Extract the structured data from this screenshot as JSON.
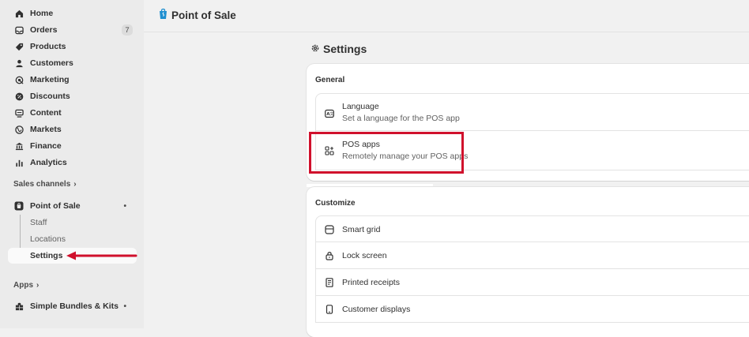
{
  "sidebar": {
    "items": [
      {
        "label": "Home",
        "icon": "home-icon"
      },
      {
        "label": "Orders",
        "icon": "inbox-icon",
        "badge": "7"
      },
      {
        "label": "Products",
        "icon": "tag-icon"
      },
      {
        "label": "Customers",
        "icon": "person-icon"
      },
      {
        "label": "Marketing",
        "icon": "target-icon"
      },
      {
        "label": "Discounts",
        "icon": "discount-icon"
      },
      {
        "label": "Content",
        "icon": "content-icon"
      },
      {
        "label": "Markets",
        "icon": "globe-icon"
      },
      {
        "label": "Finance",
        "icon": "bank-icon"
      },
      {
        "label": "Analytics",
        "icon": "bar-chart-icon"
      }
    ],
    "sales_channels_label": "Sales channels",
    "pos_label": "Point of Sale",
    "pos_subitems": [
      "Staff",
      "Locations",
      "Settings"
    ],
    "apps_label": "Apps",
    "app_item_label": "Simple Bundles & Kits",
    "menu_glyph": "•",
    "chevron": "›"
  },
  "header": {
    "app_title": "Point of Sale"
  },
  "page": {
    "title": "Settings"
  },
  "general": {
    "heading": "General",
    "rows": [
      {
        "title": "Language",
        "desc": "Set a language for the POS app",
        "icon": "language-icon"
      },
      {
        "title": "POS apps",
        "desc": "Remotely manage your POS apps",
        "icon": "apps-icon"
      }
    ]
  },
  "customize": {
    "heading": "Customize",
    "rows": [
      {
        "title": "Smart grid",
        "icon": "grid-icon"
      },
      {
        "title": "Lock screen",
        "icon": "lock-icon"
      },
      {
        "title": "Printed receipts",
        "icon": "receipt-icon"
      },
      {
        "title": "Customer displays",
        "icon": "display-icon"
      }
    ]
  },
  "colors": {
    "highlight": "#d0102c",
    "sidebar_bg": "#ebebeb",
    "page_bg": "#f1f1f1"
  }
}
